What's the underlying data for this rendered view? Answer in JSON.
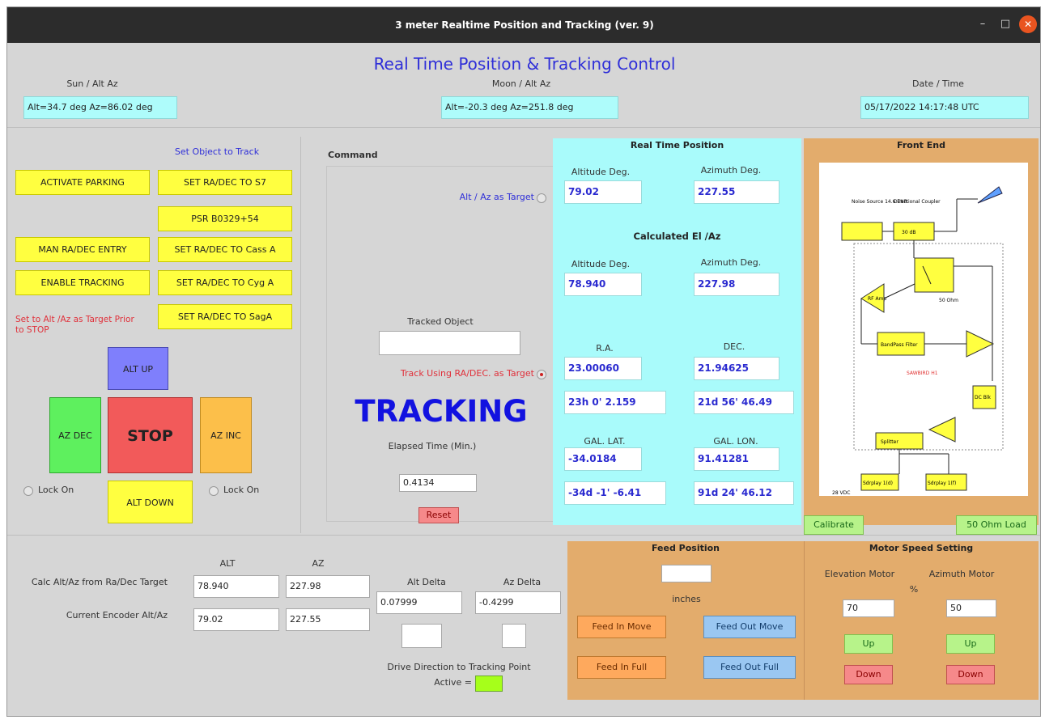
{
  "window": {
    "title": "3 meter Realtime Position and Tracking  (ver. 9)",
    "min": "–",
    "max": "□",
    "close": "✕"
  },
  "header": {
    "title": "Real Time Position & Tracking Control"
  },
  "sun": {
    "label": "Sun / Alt Az",
    "value": "Alt=34.7 deg   Az=86.02 deg"
  },
  "moon": {
    "label": "Moon / Alt Az",
    "value": "Alt=-20.3 deg   Az=251.8 deg"
  },
  "datetime": {
    "label": "Date / Time",
    "value": "05/17/2022  14:17:48 UTC"
  },
  "left": {
    "set_object_label": "Set Object to Track",
    "activate_parking": "ACTIVATE PARKING",
    "set_s7": "SET RA/DEC TO S7",
    "psr": "PSR B0329+54",
    "man_entry": "MAN RA/DEC ENTRY",
    "set_cassa": "SET RA/DEC TO Cass A",
    "enable_tracking": "ENABLE TRACKING",
    "set_cyga": "SET RA/DEC TO Cyg A",
    "set_saga": "SET RA/DEC TO SagA",
    "warning": "Set to Alt /Az as Target Prior to STOP",
    "alt_up": "ALT UP",
    "az_dec": "AZ DEC",
    "stop": "STOP",
    "az_inc": "AZ INC",
    "alt_down": "ALT DOWN",
    "lock_on_left": "Lock On",
    "lock_on_right": "Lock On"
  },
  "command": {
    "label": "Command",
    "alt_az_target": "Alt / Az as Target",
    "tracked_object_label": "Tracked Object",
    "tracked_object_value": "",
    "track_radec": "Track Using RA/DEC. as Target",
    "status": "TRACKING",
    "elapsed_label": "Elapsed Time (Min.)",
    "elapsed_value": "0.4134",
    "reset": "Reset"
  },
  "rtp": {
    "title": "Real Time Position",
    "alt_label": "Altitude Deg.",
    "az_label": "Azimuth Deg.",
    "alt": "79.02",
    "az": "227.55",
    "calc_title": "Calculated El /Az",
    "calc_alt_label": "Altitude Deg.",
    "calc_az_label": "Azimuth Deg.",
    "calc_alt": "78.940",
    "calc_az": "227.98",
    "ra_label": "R.A.",
    "dec_label": "DEC.",
    "ra": "23.00060",
    "dec": "21.94625",
    "ra_hms": "23h 0' 2.159",
    "dec_dms": "21d 56' 46.49",
    "gal_lat_label": "GAL. LAT.",
    "gal_lon_label": "GAL. LON.",
    "gal_lat": "-34.0184",
    "gal_lon": "91.41281",
    "gal_lat_dms": "-34d -1' -6.41",
    "gal_lon_dms": "91d 24' 46.12"
  },
  "frontend": {
    "title": "Front End",
    "noise": "Noise Source 14.6 ENR",
    "coupler": "Directional Coupler",
    "coupler_box": "30 dB",
    "ohm": "50 Ohm",
    "amp": "RF Amp",
    "bpf": "BandPass Filter",
    "sawbird": "SAWBIRD H1",
    "dc_blk": "DC Blk",
    "splitter": "Splitter",
    "sdr1": "Sdrplay 1(d)",
    "sdr2": "Sdrplay 1(f)",
    "vdc": "28 VDC",
    "calibrate": "Calibrate",
    "load": "50 Ohm Load"
  },
  "bottom": {
    "alt_header": "ALT",
    "az_header": "AZ",
    "calc_label": "Calc Alt/Az from Ra/Dec Target",
    "calc_alt": "78.940",
    "calc_az": "227.98",
    "enc_label": "Current Encoder Alt/Az",
    "enc_alt": "79.02",
    "enc_az": "227.55",
    "alt_delta_label": "Alt Delta",
    "az_delta_label": "Az Delta",
    "alt_delta": "0.07999",
    "az_delta": "-0.4299",
    "drive_label": "Drive Direction to Tracking Point",
    "active_label": "Active ="
  },
  "feed": {
    "title": "Feed Position",
    "value": "",
    "unit": "inches",
    "in_move": "Feed In Move",
    "out_move": "Feed Out Move",
    "in_full": "Feed In Full",
    "out_full": "Feed Out Full"
  },
  "motor": {
    "title": "Motor Speed Setting",
    "elev_label": "Elevation Motor",
    "az_label": "Azimuth Motor",
    "percent": "%",
    "elev_value": "70",
    "az_value": "50",
    "up": "Up",
    "down": "Down"
  },
  "colors": {
    "title_blue": "#2f2fd8",
    "panel_cyan": "#a9fbfb",
    "panel_orange": "#e3ac6c",
    "stop_red": "#f25a5a",
    "active_green": "#a6ff1a"
  }
}
